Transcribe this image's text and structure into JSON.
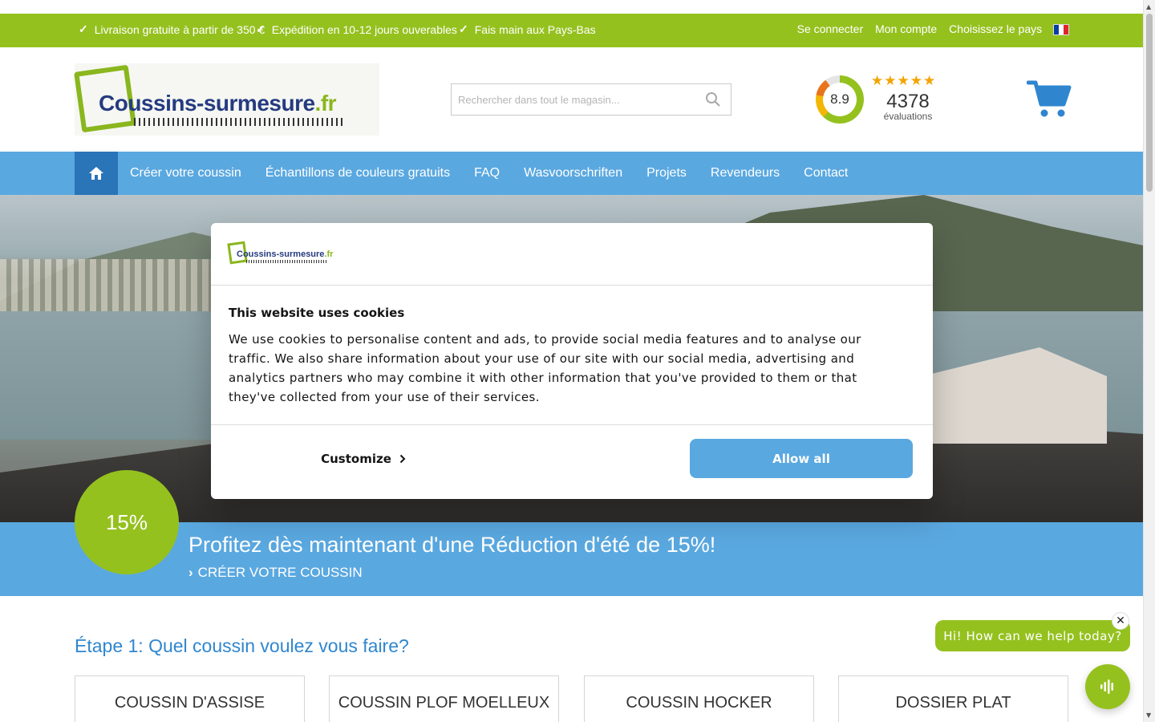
{
  "topbar": {
    "usps": [
      "Livraison gratuite à partir de 350 €",
      "Expédition en 10-12 jours ouverables",
      "Fais main aux Pays-Bas"
    ],
    "login": "Se connecter",
    "account": "Mon compte",
    "country": "Choisissez le pays",
    "country_flag": "french-flag-icon"
  },
  "header": {
    "logo_main": "Coussins-surmesure",
    "logo_tld": ".fr",
    "search_placeholder": "Rechercher dans tout le magasin...",
    "rating_score": "8.9",
    "rating_stars": "★★★★★",
    "rating_count": "4378",
    "rating_label": "évaluations",
    "cart_icon": "cart-icon"
  },
  "nav": {
    "home_icon": "home-icon",
    "items": [
      "Créer votre coussin",
      "Échantillons de couleurs gratuits",
      "FAQ",
      "Wasvoorschriften",
      "Projets",
      "Revendeurs",
      "Contact"
    ]
  },
  "promo": {
    "badge": "15%",
    "title": "Profitez dès maintenant d'une Réduction d'été de 15%!",
    "link": "CRÉER VOTRE COUSSIN"
  },
  "steps": {
    "title": "Étape 1: Quel coussin voulez vous faire?",
    "cards": [
      "COUSSIN D'ASSISE",
      "COUSSIN PLOF MOELLEUX",
      "COUSSIN HOCKER",
      "DOSSIER PLAT"
    ]
  },
  "cookie": {
    "logo_main": "Coussins-surmesure",
    "logo_tld": ".fr",
    "title": "This website uses cookies",
    "body": "We use cookies to personalise content and ads, to provide social media features and to analyse our traffic. We also share information about your use of our site with our social media, advertising and analytics partners who may combine it with other information that you've provided to them or that they've collected from your use of their services.",
    "customize": "Customize",
    "allow_all": "Allow all"
  },
  "chat": {
    "greeting": "Hi! How can we help today?",
    "close": "✕"
  },
  "colors": {
    "green": "#95c11f",
    "blue": "#5aa8e0",
    "dark_blue": "#2a74b8"
  }
}
